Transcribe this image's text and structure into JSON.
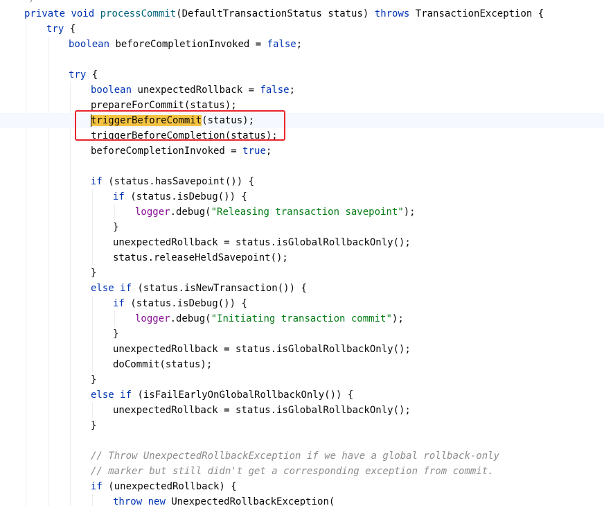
{
  "editor": {
    "language": "java",
    "current_line": 8,
    "colors": {
      "keyword": "#0033b3",
      "method_declaration": "#00627a",
      "string": "#067d17",
      "comment": "#8c8c8c",
      "field": "#871094",
      "plain": "#080808",
      "search_highlight": "#f5c342",
      "annotation_box": "#e8252b"
    },
    "lines": [
      {
        "indent": 1,
        "tokens": [
          {
            "t": "*/",
            "k": "cm"
          }
        ]
      },
      {
        "indent": 1,
        "tokens": [
          {
            "t": "private",
            "k": "kw"
          },
          {
            "t": " ",
            "k": "pl"
          },
          {
            "t": "void",
            "k": "kw"
          },
          {
            "t": " ",
            "k": "pl"
          },
          {
            "t": "processCommit",
            "k": "fn"
          },
          {
            "t": "(DefaultTransactionStatus status) ",
            "k": "pl"
          },
          {
            "t": "throws",
            "k": "kw"
          },
          {
            "t": " TransactionException {",
            "k": "pl"
          }
        ]
      },
      {
        "indent": 2,
        "tokens": [
          {
            "t": "try",
            "k": "kw"
          },
          {
            "t": " {",
            "k": "pl"
          }
        ]
      },
      {
        "indent": 3,
        "tokens": [
          {
            "t": "boolean",
            "k": "kw"
          },
          {
            "t": " beforeCompletionInvoked = ",
            "k": "pl"
          },
          {
            "t": "false",
            "k": "kw"
          },
          {
            "t": ";",
            "k": "pl"
          }
        ]
      },
      {
        "indent": 0,
        "tokens": []
      },
      {
        "indent": 3,
        "tokens": [
          {
            "t": "try",
            "k": "kw"
          },
          {
            "t": " {",
            "k": "pl"
          }
        ]
      },
      {
        "indent": 4,
        "tokens": [
          {
            "t": "boolean",
            "k": "kw"
          },
          {
            "t": " unexpectedRollback = ",
            "k": "pl"
          },
          {
            "t": "false",
            "k": "kw"
          },
          {
            "t": ";",
            "k": "pl"
          }
        ]
      },
      {
        "indent": 4,
        "tokens": [
          {
            "t": "prepareForCommit(status);",
            "k": "pl"
          }
        ]
      },
      {
        "indent": 4,
        "tokens": [
          {
            "t": "triggerBeforeCommit",
            "k": "hl"
          },
          {
            "t": "(status);",
            "k": "pl"
          }
        ]
      },
      {
        "indent": 4,
        "tokens": [
          {
            "t": "triggerBeforeCompletion(status);",
            "k": "pl"
          }
        ]
      },
      {
        "indent": 4,
        "tokens": [
          {
            "t": "beforeCompletionInvoked = ",
            "k": "pl"
          },
          {
            "t": "true",
            "k": "kw"
          },
          {
            "t": ";",
            "k": "pl"
          }
        ]
      },
      {
        "indent": 0,
        "tokens": []
      },
      {
        "indent": 4,
        "tokens": [
          {
            "t": "if",
            "k": "kw"
          },
          {
            "t": " (status.hasSavepoint()) {",
            "k": "pl"
          }
        ]
      },
      {
        "indent": 5,
        "tokens": [
          {
            "t": "if",
            "k": "kw"
          },
          {
            "t": " (status.isDebug()) {",
            "k": "pl"
          }
        ]
      },
      {
        "indent": 6,
        "tokens": [
          {
            "t": "logger",
            "k": "field"
          },
          {
            "t": ".debug(",
            "k": "pl"
          },
          {
            "t": "\"Releasing transaction savepoint\"",
            "k": "str"
          },
          {
            "t": ");",
            "k": "pl"
          }
        ]
      },
      {
        "indent": 5,
        "tokens": [
          {
            "t": "}",
            "k": "pl"
          }
        ]
      },
      {
        "indent": 5,
        "tokens": [
          {
            "t": "unexpectedRollback = status.isGlobalRollbackOnly();",
            "k": "pl"
          }
        ]
      },
      {
        "indent": 5,
        "tokens": [
          {
            "t": "status.releaseHeldSavepoint();",
            "k": "pl"
          }
        ]
      },
      {
        "indent": 4,
        "tokens": [
          {
            "t": "}",
            "k": "pl"
          }
        ]
      },
      {
        "indent": 4,
        "tokens": [
          {
            "t": "else",
            "k": "kw"
          },
          {
            "t": " ",
            "k": "pl"
          },
          {
            "t": "if",
            "k": "kw"
          },
          {
            "t": " (status.isNewTransaction()) {",
            "k": "pl"
          }
        ]
      },
      {
        "indent": 5,
        "tokens": [
          {
            "t": "if",
            "k": "kw"
          },
          {
            "t": " (status.isDebug()) {",
            "k": "pl"
          }
        ]
      },
      {
        "indent": 6,
        "tokens": [
          {
            "t": "logger",
            "k": "field"
          },
          {
            "t": ".debug(",
            "k": "pl"
          },
          {
            "t": "\"Initiating transaction commit\"",
            "k": "str"
          },
          {
            "t": ");",
            "k": "pl"
          }
        ]
      },
      {
        "indent": 5,
        "tokens": [
          {
            "t": "}",
            "k": "pl"
          }
        ]
      },
      {
        "indent": 5,
        "tokens": [
          {
            "t": "unexpectedRollback = status.isGlobalRollbackOnly();",
            "k": "pl"
          }
        ]
      },
      {
        "indent": 5,
        "tokens": [
          {
            "t": "doCommit(status);",
            "k": "pl"
          }
        ]
      },
      {
        "indent": 4,
        "tokens": [
          {
            "t": "}",
            "k": "pl"
          }
        ]
      },
      {
        "indent": 4,
        "tokens": [
          {
            "t": "else",
            "k": "kw"
          },
          {
            "t": " ",
            "k": "pl"
          },
          {
            "t": "if",
            "k": "kw"
          },
          {
            "t": " (isFailEarlyOnGlobalRollbackOnly()) {",
            "k": "pl"
          }
        ]
      },
      {
        "indent": 5,
        "tokens": [
          {
            "t": "unexpectedRollback = status.isGlobalRollbackOnly();",
            "k": "pl"
          }
        ]
      },
      {
        "indent": 4,
        "tokens": [
          {
            "t": "}",
            "k": "pl"
          }
        ]
      },
      {
        "indent": 0,
        "tokens": []
      },
      {
        "indent": 4,
        "tokens": [
          {
            "t": "// Throw UnexpectedRollbackException if we have a global rollback-only",
            "k": "cm"
          }
        ]
      },
      {
        "indent": 4,
        "tokens": [
          {
            "t": "// marker but still didn't get a corresponding exception from commit.",
            "k": "cm"
          }
        ]
      },
      {
        "indent": 4,
        "tokens": [
          {
            "t": "if",
            "k": "kw"
          },
          {
            "t": " (unexpectedRollback) {",
            "k": "pl"
          }
        ]
      },
      {
        "indent": 5,
        "tokens": [
          {
            "t": "throw",
            "k": "kw"
          },
          {
            "t": " ",
            "k": "pl"
          },
          {
            "t": "new",
            "k": "kw"
          },
          {
            "t": " UnexpectedRollbackException(",
            "k": "pl"
          }
        ]
      }
    ]
  }
}
